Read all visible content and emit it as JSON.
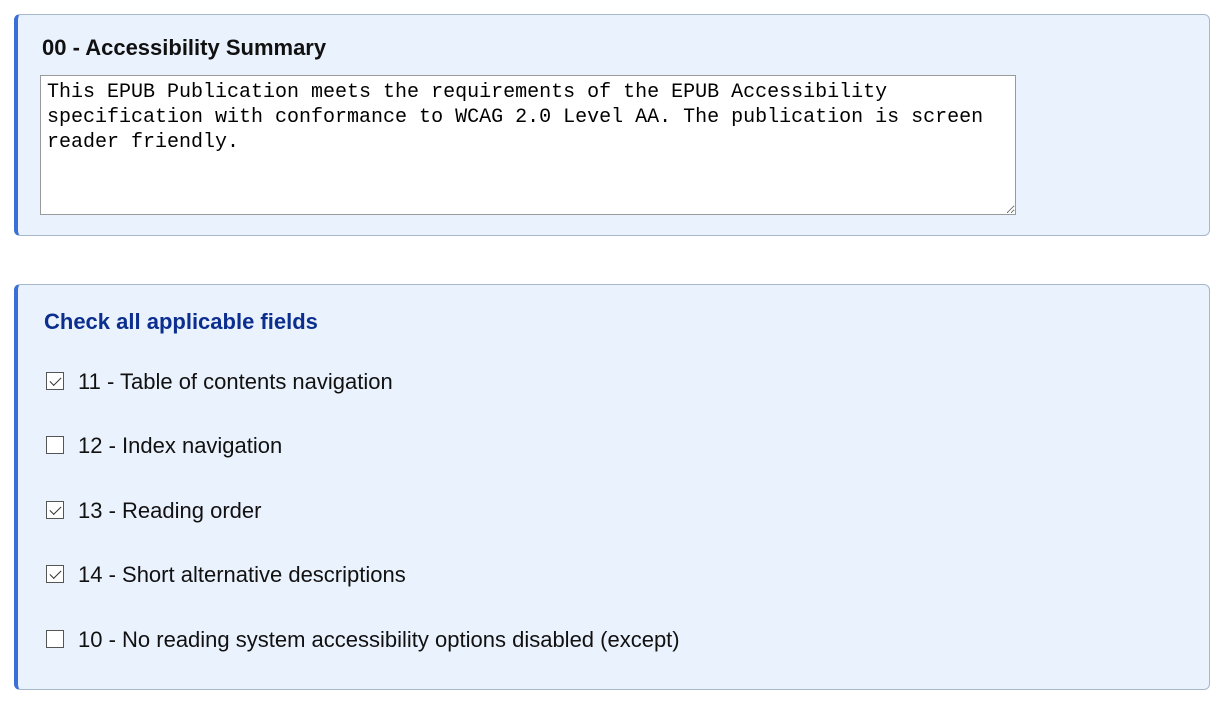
{
  "summary_panel": {
    "title": "00 - Accessibility Summary",
    "text": "This EPUB Publication meets the requirements of the EPUB Accessibility specification with conformance to WCAG 2.0 Level AA. The publication is screen reader friendly."
  },
  "fields_panel": {
    "title": "Check all applicable fields",
    "items": [
      {
        "label": "11 - Table of contents navigation",
        "checked": true
      },
      {
        "label": "12 - Index navigation",
        "checked": false
      },
      {
        "label": "13 - Reading order",
        "checked": true
      },
      {
        "label": "14 - Short alternative descriptions",
        "checked": true
      },
      {
        "label": "10 - No reading system accessibility options disabled (except)",
        "checked": false
      }
    ]
  }
}
